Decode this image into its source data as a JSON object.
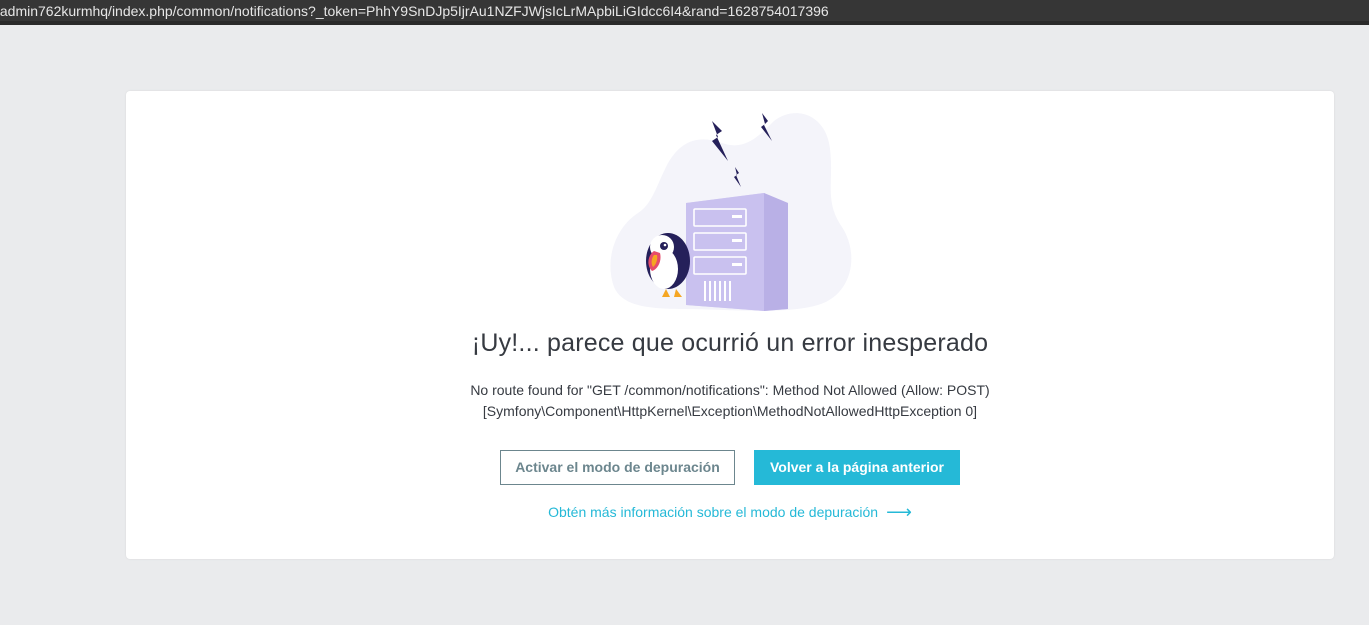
{
  "browser": {
    "url": "/admin762kurmhq/index.php/common/notifications?_token=PhhY9SnDJp5IjrAu1NZFJWjsIcLrMApbiLiGIdcc6I4&rand=1628754017396"
  },
  "error_page": {
    "title": "¡Uy!... parece que ocurrió un error inesperado",
    "message_line1": "No route found for \"GET /common/notifications\": Method Not Allowed (Allow: POST)",
    "message_line2": "[Symfony\\Component\\HttpKernel\\Exception\\MethodNotAllowedHttpException 0]",
    "debug_button": "Activar el modo de depuración",
    "back_button": "Volver a la página anterior",
    "more_info_link": "Obtén más información sobre el modo de depuración",
    "more_info_arrow_icon": "arrow-right-icon"
  },
  "colors": {
    "accent": "#25b9d7",
    "outline": "#6c868e",
    "text": "#363a41",
    "server": "#c9c1ef",
    "blob": "#f4f4fa",
    "bolt": "#25205a"
  }
}
